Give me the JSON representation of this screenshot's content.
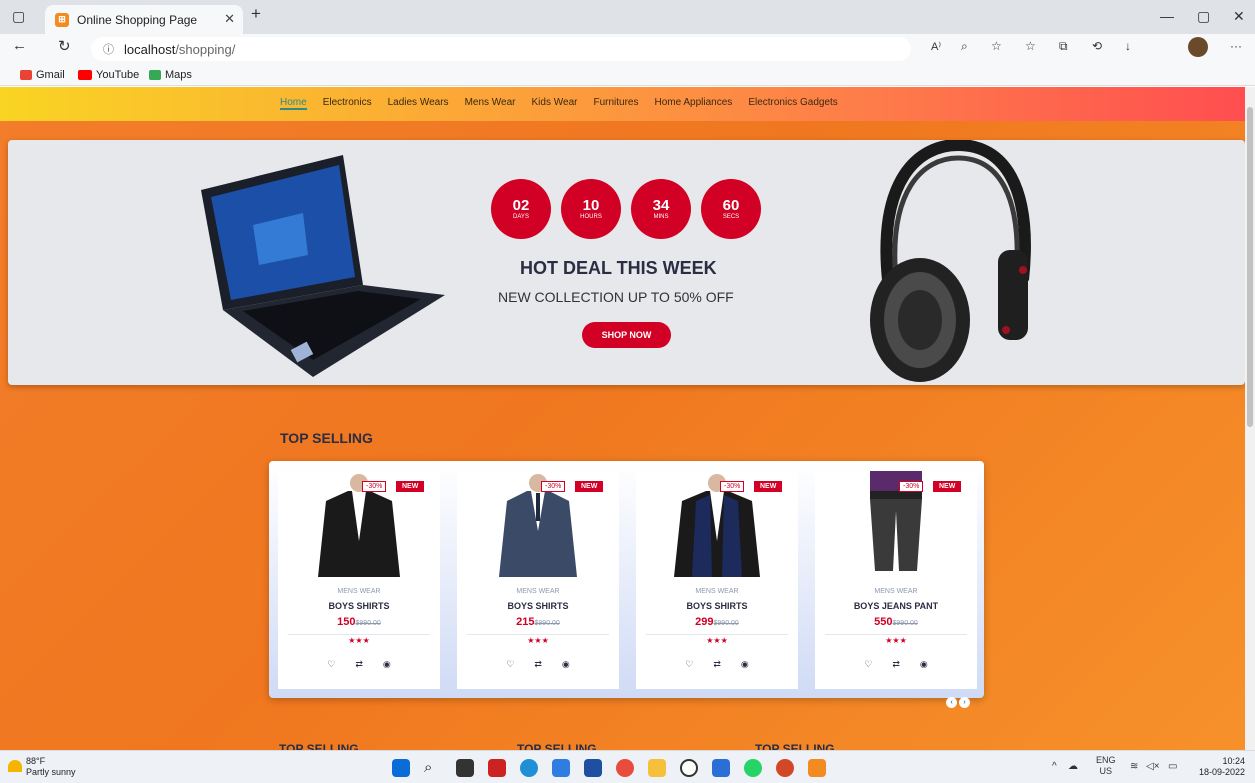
{
  "browser": {
    "tab_title": "Online Shopping Page",
    "url_host": "localhost",
    "url_path": "/shopping/",
    "bookmarks": [
      "Gmail",
      "YouTube",
      "Maps"
    ]
  },
  "nav": {
    "links": [
      "Home",
      "Electronics",
      "Ladies Wears",
      "Mens Wear",
      "Kids Wear",
      "Furnitures",
      "Home Appliances",
      "Electronics Gadgets"
    ]
  },
  "hero": {
    "countdown": [
      {
        "num": "02",
        "unit": "DAYS"
      },
      {
        "num": "10",
        "unit": "HOURS"
      },
      {
        "num": "34",
        "unit": "MINS"
      },
      {
        "num": "60",
        "unit": "SECS"
      }
    ],
    "title": "HOT DEAL THIS WEEK",
    "subtitle": "NEW COLLECTION UP TO 50% OFF",
    "button": "SHOP NOW"
  },
  "top_selling": {
    "title": "TOP SELLING",
    "products": [
      {
        "category": "MENS WEAR",
        "name": "BOYS SHIRTS",
        "price": "150",
        "old_price": "$990.00",
        "sale": "-30%",
        "badge": "NEW",
        "stars": "★★★"
      },
      {
        "category": "MENS WEAR",
        "name": "BOYS SHIRTS",
        "price": "215",
        "old_price": "$990.00",
        "sale": "-30%",
        "badge": "NEW",
        "stars": "★★★"
      },
      {
        "category": "MENS WEAR",
        "name": "BOYS SHIRTS",
        "price": "299",
        "old_price": "$990.00",
        "sale": "-30%",
        "badge": "NEW",
        "stars": "★★★"
      },
      {
        "category": "MENS WEAR",
        "name": "BOYS JEANS PANT",
        "price": "550",
        "old_price": "$990.00",
        "sale": "-30%",
        "badge": "NEW",
        "stars": "★★★"
      }
    ]
  },
  "bottom_titles": [
    "TOP SELLING",
    "TOP SELLING",
    "TOP SELLING"
  ],
  "taskbar": {
    "temp": "88°F",
    "weather": "Partly sunny",
    "lang": "ENG",
    "region": "US",
    "time": "10:24",
    "date": "18-09-2022"
  },
  "colors": {
    "accent": "#d10024",
    "text_dark": "#2b2d42"
  }
}
